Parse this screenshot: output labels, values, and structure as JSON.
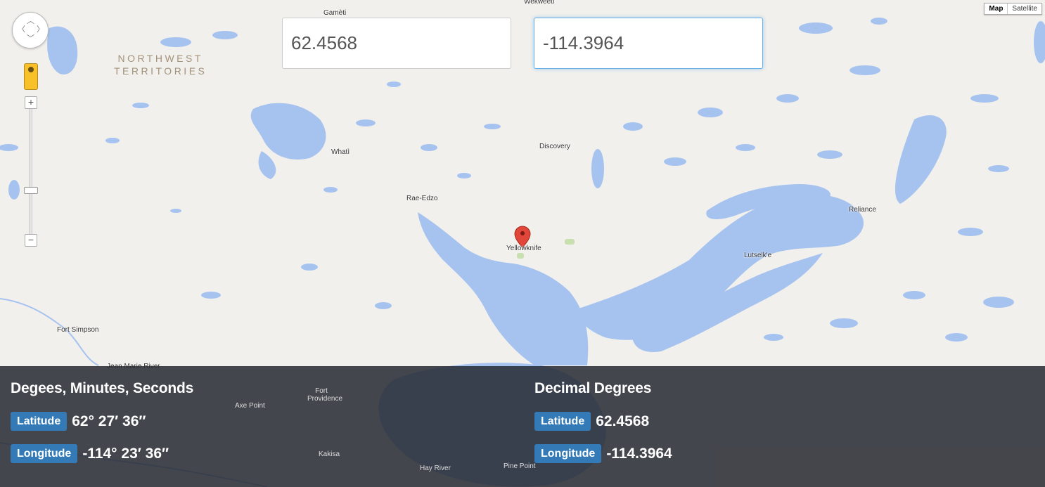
{
  "map": {
    "region_label_line1": "NORTHWEST",
    "region_label_line2": "TERRITORIES",
    "places": [
      "Gamèti",
      "Wekweètì",
      "Whatì",
      "Discovery",
      "Rae-Edzo",
      "Yellowknife",
      "Reliance",
      "Lutselk'e",
      "Fort Simpson",
      "Jean Marie River",
      "Fort Providence",
      "Axe Point",
      "Kakisa",
      "Hay River",
      "Pine Point"
    ],
    "map_type": {
      "map": "Map",
      "satellite": "Satellite",
      "active": "Map"
    },
    "zoom": {
      "in": "+",
      "out": "−"
    },
    "colors": {
      "land": "#f2f0ec",
      "water": "#a6c3f0",
      "marker": "#e0473a",
      "park": "#c8dfb0"
    }
  },
  "inputs": {
    "latitude": "62.4568",
    "longitude": "-114.3964"
  },
  "panel": {
    "dms": {
      "title": "Degees, Minutes, Seconds",
      "latitude_label": "Latitude",
      "latitude_value": "62° 27′ 36″",
      "longitude_label": "Longitude",
      "longitude_value": "-114° 23′ 36″"
    },
    "decimal": {
      "title": "Decimal Degrees",
      "latitude_label": "Latitude",
      "latitude_value": "62.4568",
      "longitude_label": "Longitude",
      "longitude_value": "-114.3964"
    },
    "badge_color": "#337ab7"
  }
}
